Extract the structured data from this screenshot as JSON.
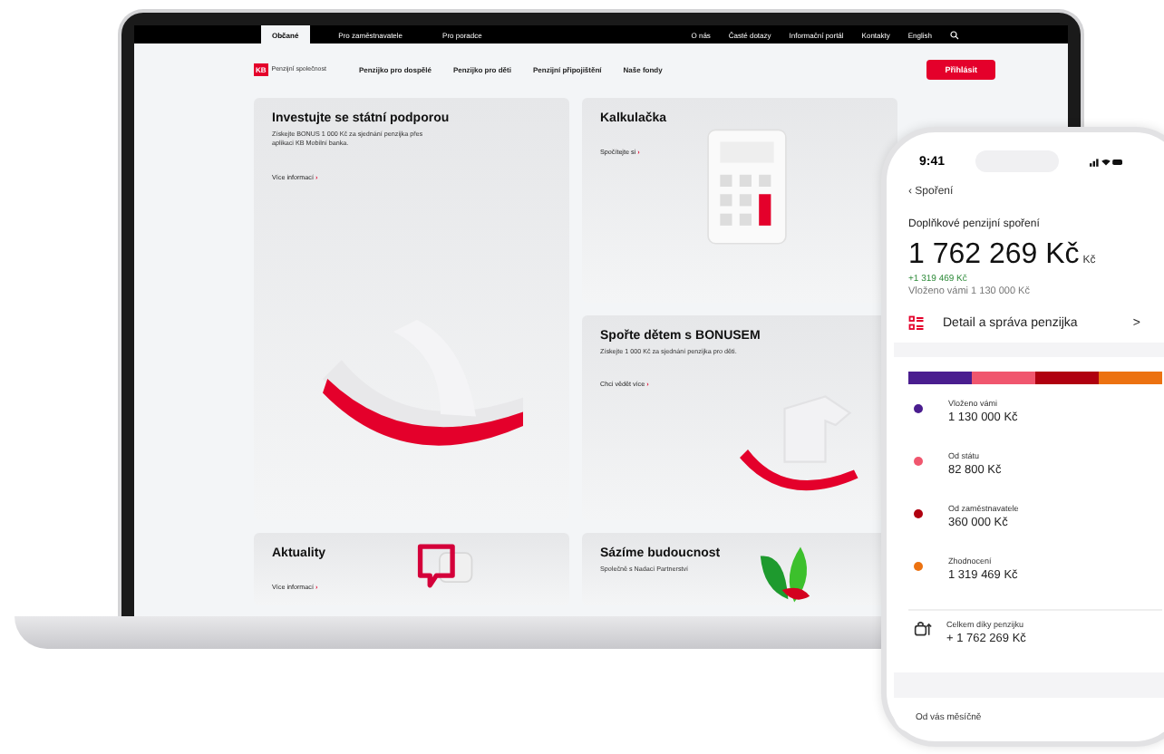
{
  "laptop": {
    "top_bar": {
      "tabs": [
        {
          "label": "Občané",
          "selected": true
        },
        {
          "label": "Pro zaměstnavatele",
          "selected": false
        },
        {
          "label": "Pro poradce",
          "selected": false
        }
      ],
      "links": [
        "O nás",
        "Časté dotazy",
        "Informační portál",
        "Kontakty",
        "English"
      ]
    },
    "header": {
      "logo_mark": "KB",
      "logo_text": "Penzijní společnost",
      "menu": [
        "Penzijko pro dospělé",
        "Penzijko pro děti",
        "Penzijní připojištění",
        "Naše fondy"
      ],
      "login_button": "Přihlásit"
    },
    "cards": [
      {
        "kind": "chair",
        "arrow": "›",
        "title": "Investujte se státní podporou",
        "text": "Získejte BONUS 1 000 Kč za sjednání penzijka přes aplikaci KB Mobilní banka.",
        "link": "Více informací"
      },
      {
        "kind": "calculator",
        "arrow": "›",
        "title": "Kalkulačka",
        "link": "Spočítejte si"
      },
      {
        "kind": "horse",
        "arrow": "›",
        "title": "Spořte dětem s BONUSEM",
        "text": "Získejte 1 000 Kč za sjednání penzijka pro děti.",
        "link": "Chci vědět více"
      },
      {
        "kind": "bubble",
        "arrow": "›",
        "title": "Aktuality",
        "link": "Více informací"
      },
      {
        "kind": "leaves",
        "title": "Sázíme budoucnost",
        "text": "Společně s Nadací Partnerství"
      }
    ]
  },
  "phone": {
    "time": "9:41",
    "back_icon": "‹",
    "back": "Spoření",
    "title": "Doplňkové penzijní spoření",
    "amount": "1 762 269 Kč",
    "amount_unit": "Kč",
    "gain": "+1 319 469 Kč",
    "deposited": "Vloženo vámi 1 130 000 Kč",
    "detail_link": "Detail a správa penzijka",
    "chevron": ">",
    "breakdown": [
      {
        "label": "Vloženo vámi",
        "value": "1 130 000 Kč",
        "color": "#4a1d8f"
      },
      {
        "label": "Od státu",
        "value": "82 800 Kč",
        "color": "#f0566e"
      },
      {
        "label": "Od zaměstnavatele",
        "value": "360 000 Kč",
        "color": "#b00010"
      },
      {
        "label": "Zhodnocení",
        "value": "1 319 469 Kč",
        "color": "#ec7211"
      }
    ],
    "total": {
      "label": "Celkem díky penzijku",
      "value": "+ 1 762 269 Kč"
    },
    "monthly_label": "Od vás měsíčně"
  }
}
